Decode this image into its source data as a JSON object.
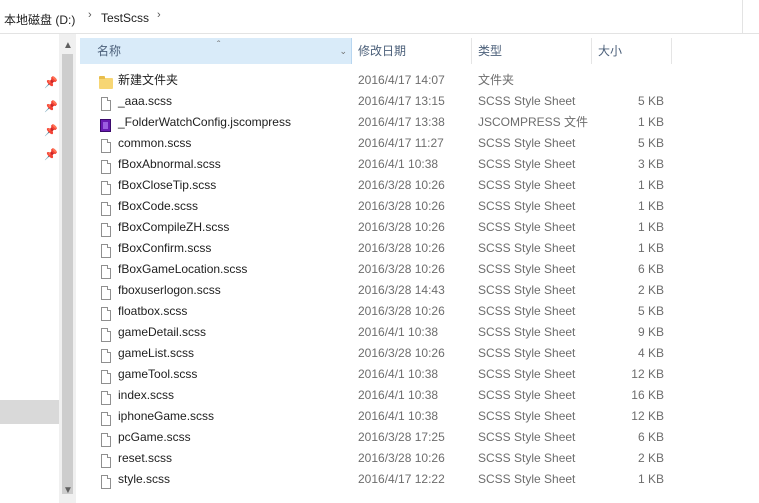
{
  "breadcrumb": {
    "items": [
      "本地磁盘 (D:)",
      "TestScss"
    ],
    "separator": "›"
  },
  "columns": {
    "name": "名称",
    "date": "修改日期",
    "type": "类型",
    "size": "大小"
  },
  "files": [
    {
      "name": "新建文件夹",
      "date": "2016/4/17 14:07",
      "type": "文件夹",
      "size": "",
      "icon": "folder-icon"
    },
    {
      "name": "_aaa.scss",
      "date": "2016/4/17 13:15",
      "type": "SCSS Style Sheet",
      "size": "5 KB",
      "icon": "file-icon"
    },
    {
      "name": "_FolderWatchConfig.jscompress",
      "date": "2016/4/17 13:38",
      "type": "JSCOMPRESS 文件",
      "size": "1 KB",
      "icon": "jscompress-icon"
    },
    {
      "name": "common.scss",
      "date": "2016/4/17 11:27",
      "type": "SCSS Style Sheet",
      "size": "5 KB",
      "icon": "file-icon"
    },
    {
      "name": "fBoxAbnormal.scss",
      "date": "2016/4/1 10:38",
      "type": "SCSS Style Sheet",
      "size": "3 KB",
      "icon": "file-icon"
    },
    {
      "name": "fBoxCloseTip.scss",
      "date": "2016/3/28 10:26",
      "type": "SCSS Style Sheet",
      "size": "1 KB",
      "icon": "file-icon"
    },
    {
      "name": "fBoxCode.scss",
      "date": "2016/3/28 10:26",
      "type": "SCSS Style Sheet",
      "size": "1 KB",
      "icon": "file-icon"
    },
    {
      "name": "fBoxCompileZH.scss",
      "date": "2016/3/28 10:26",
      "type": "SCSS Style Sheet",
      "size": "1 KB",
      "icon": "file-icon"
    },
    {
      "name": "fBoxConfirm.scss",
      "date": "2016/3/28 10:26",
      "type": "SCSS Style Sheet",
      "size": "1 KB",
      "icon": "file-icon"
    },
    {
      "name": "fBoxGameLocation.scss",
      "date": "2016/3/28 10:26",
      "type": "SCSS Style Sheet",
      "size": "6 KB",
      "icon": "file-icon"
    },
    {
      "name": "fboxuserlogon.scss",
      "date": "2016/3/28 14:43",
      "type": "SCSS Style Sheet",
      "size": "2 KB",
      "icon": "file-icon"
    },
    {
      "name": "floatbox.scss",
      "date": "2016/3/28 10:26",
      "type": "SCSS Style Sheet",
      "size": "5 KB",
      "icon": "file-icon"
    },
    {
      "name": "gameDetail.scss",
      "date": "2016/4/1 10:38",
      "type": "SCSS Style Sheet",
      "size": "9 KB",
      "icon": "file-icon"
    },
    {
      "name": "gameList.scss",
      "date": "2016/3/28 10:26",
      "type": "SCSS Style Sheet",
      "size": "4 KB",
      "icon": "file-icon"
    },
    {
      "name": "gameTool.scss",
      "date": "2016/4/1 10:38",
      "type": "SCSS Style Sheet",
      "size": "12 KB",
      "icon": "file-icon"
    },
    {
      "name": "index.scss",
      "date": "2016/4/1 10:38",
      "type": "SCSS Style Sheet",
      "size": "16 KB",
      "icon": "file-icon"
    },
    {
      "name": "iphoneGame.scss",
      "date": "2016/4/1 10:38",
      "type": "SCSS Style Sheet",
      "size": "12 KB",
      "icon": "file-icon"
    },
    {
      "name": "pcGame.scss",
      "date": "2016/3/28 17:25",
      "type": "SCSS Style Sheet",
      "size": "6 KB",
      "icon": "file-icon"
    },
    {
      "name": "reset.scss",
      "date": "2016/3/28 10:26",
      "type": "SCSS Style Sheet",
      "size": "2 KB",
      "icon": "file-icon"
    },
    {
      "name": "style.scss",
      "date": "2016/4/17 12:22",
      "type": "SCSS Style Sheet",
      "size": "1 KB",
      "icon": "file-icon"
    }
  ],
  "colors": {
    "header_sorted_bg": "#d9ebf9",
    "folder_icon": "#f7d674",
    "jscompress_icon": "#6a1bb3"
  }
}
